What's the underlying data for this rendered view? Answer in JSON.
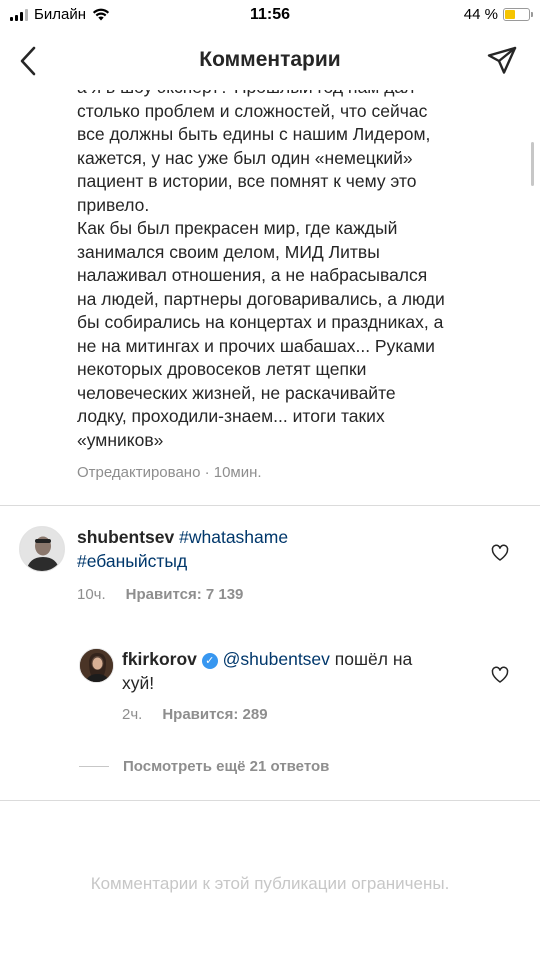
{
  "status_bar": {
    "carrier": "Билайн",
    "time": "11:56",
    "battery": "44 %",
    "battery_level": 0.44
  },
  "nav": {
    "title": "Комментарии"
  },
  "main_comment": {
    "lines": [
      "а я в шоу эксперт? Прошлый год нам дал",
      "столько проблем и сложностей, что сейчас",
      "все должны быть едины с нашим Лидером,",
      "кажется, у нас уже был один «немецкий»",
      "пациент в истории, все помнят к чему это",
      "привело.",
      "Как бы был прекрасен мир, где каждый",
      "занимался своим делом, МИД Литвы",
      "налаживал отношения, а не набрасывался",
      "на людей, партнеры договаривались, а люди",
      "бы собирались на концертах и праздниках, а",
      "не на митингах и прочих шабашах... Руками",
      "некоторых дровосеков летят щепки",
      "человеческих жизней, не раскачивайте",
      "лодку, проходили-знаем... итоги таких",
      "«умников»"
    ],
    "meta": "Отредактировано · 10мин."
  },
  "reply1": {
    "username": "shubentsev",
    "hashtag1": "#whatashame",
    "hashtag2": "#ебаныйстыд",
    "time": "10ч.",
    "likes": "Нравится: 7 139"
  },
  "reply2": {
    "username": "fkirkorov",
    "mention": "@shubentsev",
    "text_part1": " пошёл на",
    "text_part2": "хуй!",
    "time": "2ч.",
    "likes": "Нравится: 289"
  },
  "view_more": "Посмотреть ещё 21 ответов",
  "restricted_notice": "Комментарии к этой публикации ограничены."
}
